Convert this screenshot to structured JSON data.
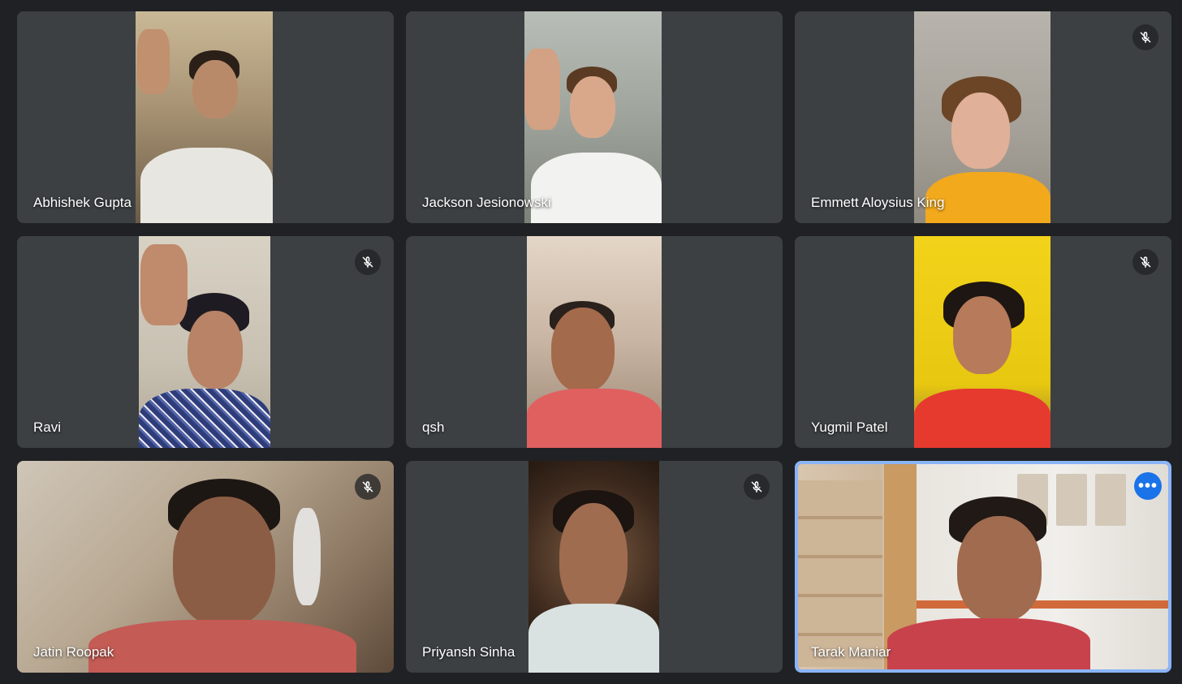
{
  "participants": [
    {
      "name": "Abhishek Gupta",
      "muted": false
    },
    {
      "name": "Jackson Jesionowski",
      "muted": false
    },
    {
      "name": "Emmett Aloysius King",
      "muted": true
    },
    {
      "name": "Ravi",
      "muted": true
    },
    {
      "name": "qsh",
      "muted": false
    },
    {
      "name": "Yugmil Patel",
      "muted": true
    },
    {
      "name": "Jatin Roopak",
      "muted": true
    },
    {
      "name": "Priyansh Sinha",
      "muted": true
    },
    {
      "name": "Tarak Maniar",
      "muted": false,
      "is_self": true
    }
  ],
  "controls": {
    "more_options_icon": "more-horizontal-icon",
    "mute_icon": "mic-off-icon"
  },
  "colors": {
    "background": "#202124",
    "tile": "#3c4043",
    "self_outline": "#8ab4f8",
    "accent": "#1a73e8"
  }
}
